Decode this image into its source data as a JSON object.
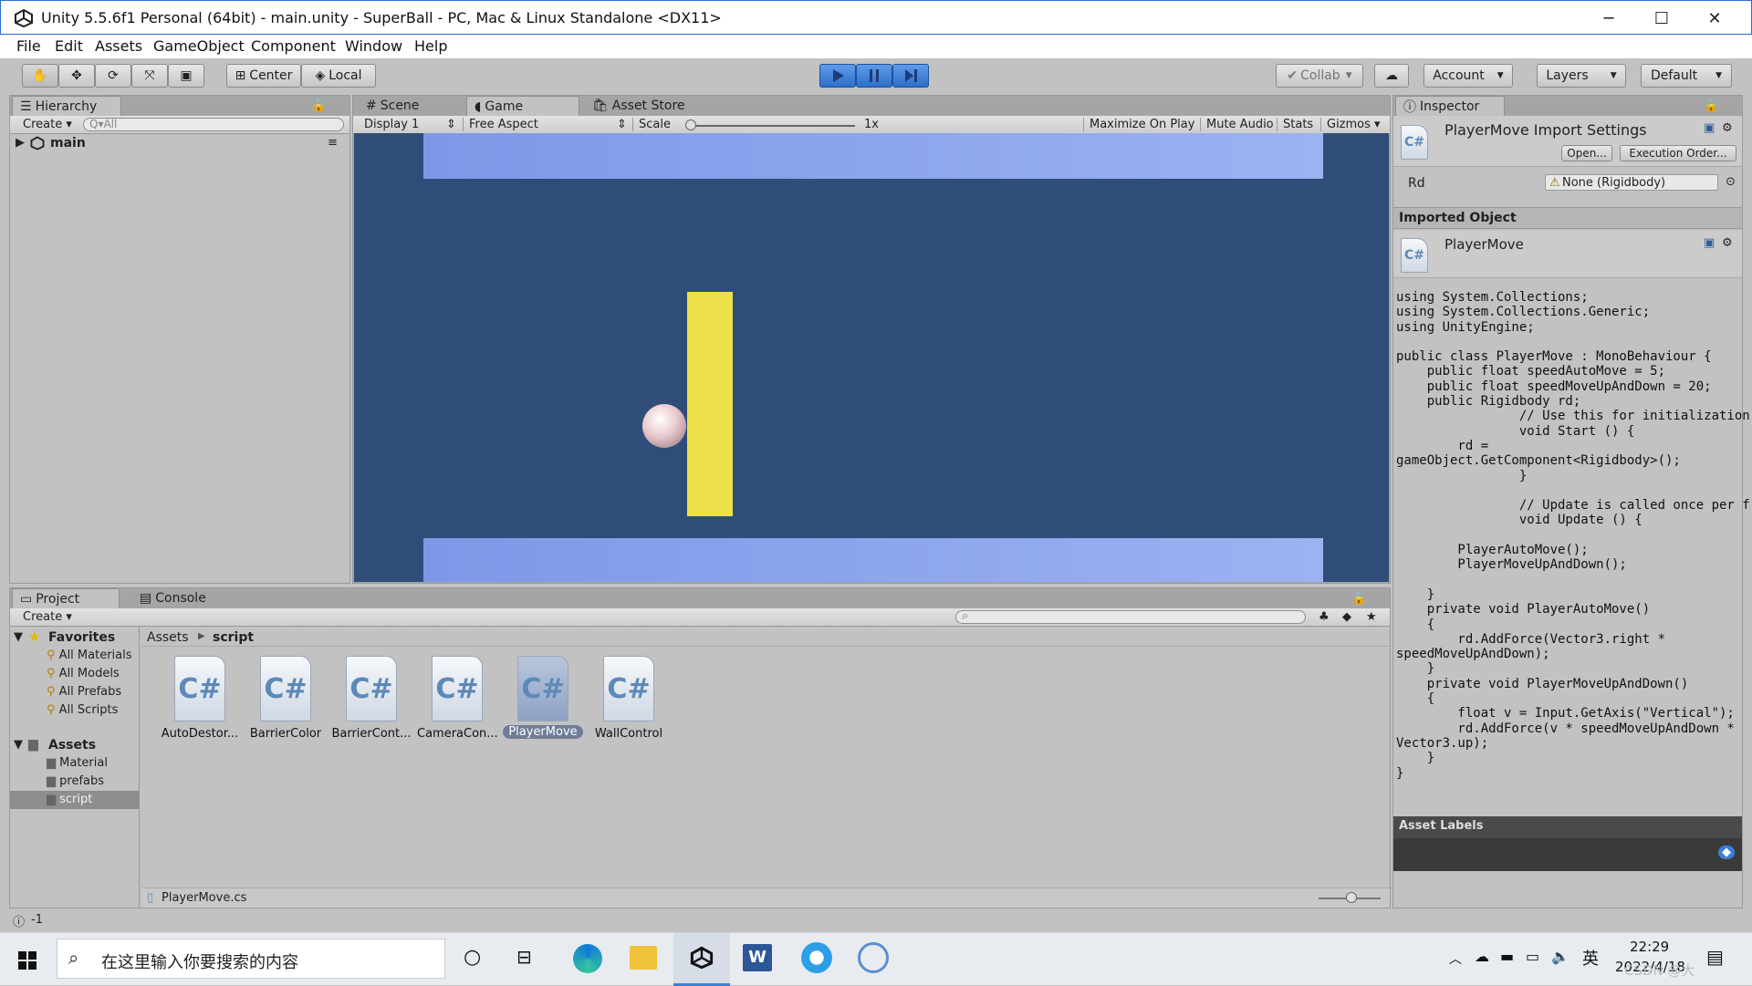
{
  "window": {
    "title": "Unity 5.5.6f1 Personal (64bit) - main.unity - SuperBall - PC, Mac & Linux Standalone <DX11>",
    "minimize": "─",
    "maximize": "☐",
    "close": "✕"
  },
  "menu": [
    "File",
    "Edit",
    "Assets",
    "GameObject",
    "Component",
    "Window",
    "Help"
  ],
  "toolbar": {
    "pivot": "Center",
    "space": "Local",
    "collab": "Collab",
    "account": "Account",
    "layers": "Layers",
    "layout": "Default"
  },
  "hierarchy": {
    "tab": "Hierarchy",
    "create": "Create",
    "search_placeholder": "Q▾All",
    "scene": "main"
  },
  "center_tabs": {
    "scene": "Scene",
    "game": "Game",
    "asset_store": "Asset Store"
  },
  "game_bar": {
    "display": "Display 1",
    "aspect": "Free Aspect",
    "scale_label": "Scale",
    "scale_value": "1x",
    "maximize": "Maximize On Play",
    "mute": "Mute Audio",
    "stats": "Stats",
    "gizmos": "Gizmos"
  },
  "project": {
    "tab": "Project",
    "console_tab": "Console",
    "create": "Create",
    "favorites_label": "Favorites",
    "favorites": [
      "All Materials",
      "All Models",
      "All Prefabs",
      "All Scripts"
    ],
    "assets_label": "Assets",
    "folders": [
      "Material",
      "prefabs",
      "script"
    ],
    "breadcrumb_root": "Assets",
    "breadcrumb_current": "script",
    "files": [
      {
        "label": "AutoDestor..."
      },
      {
        "label": "BarrierColor"
      },
      {
        "label": "BarrierCont..."
      },
      {
        "label": "CameraCon..."
      },
      {
        "label": "PlayerMove"
      },
      {
        "label": "WallControl"
      }
    ],
    "selected_file": "PlayerMove.cs"
  },
  "inspector": {
    "tab": "Inspector",
    "title": "PlayerMove Import Settings",
    "open": "Open...",
    "execution_order": "Execution Order...",
    "field_label": "Rd",
    "field_value": "None (Rigidbody)",
    "imported_header": "Imported Object",
    "imported_name": "PlayerMove",
    "code": "using System.Collections;\nusing System.Collections.Generic;\nusing UnityEngine;\n\npublic class PlayerMove : MonoBehaviour {\n    public float speedAutoMove = 5;\n    public float speedMoveUpAndDown = 20;\n    public Rigidbody rd;\n                // Use this for initialization\n                void Start () {\n        rd =\ngameObject.GetComponent<Rigidbody>();\n                }\n\n                // Update is called once per frame\n                void Update () {\n\n        PlayerAutoMove();\n        PlayerMoveUpAndDown();\n\n    }\n    private void PlayerAutoMove()\n    {\n        rd.AddForce(Vector3.right *\nspeedMoveUpAndDown);\n    }\n    private void PlayerMoveUpAndDown()\n    {\n        float v = Input.GetAxis(\"Vertical\");\n        rd.AddForce(v * speedMoveUpAndDown *\nVector3.up);\n    }\n}",
    "asset_labels": "Asset Labels"
  },
  "status": {
    "text": "-1"
  },
  "taskbar": {
    "search_placeholder": "在这里输入你要搜索的内容",
    "time": "22:29",
    "date": "2022/4/18",
    "ime": "英",
    "watermark": "CSDN @大"
  },
  "colors": {
    "game_bg": "#2f4d78",
    "platform": "#8aa3ee",
    "barrier": "#ece14a",
    "play_active": "#3d7fd6"
  }
}
